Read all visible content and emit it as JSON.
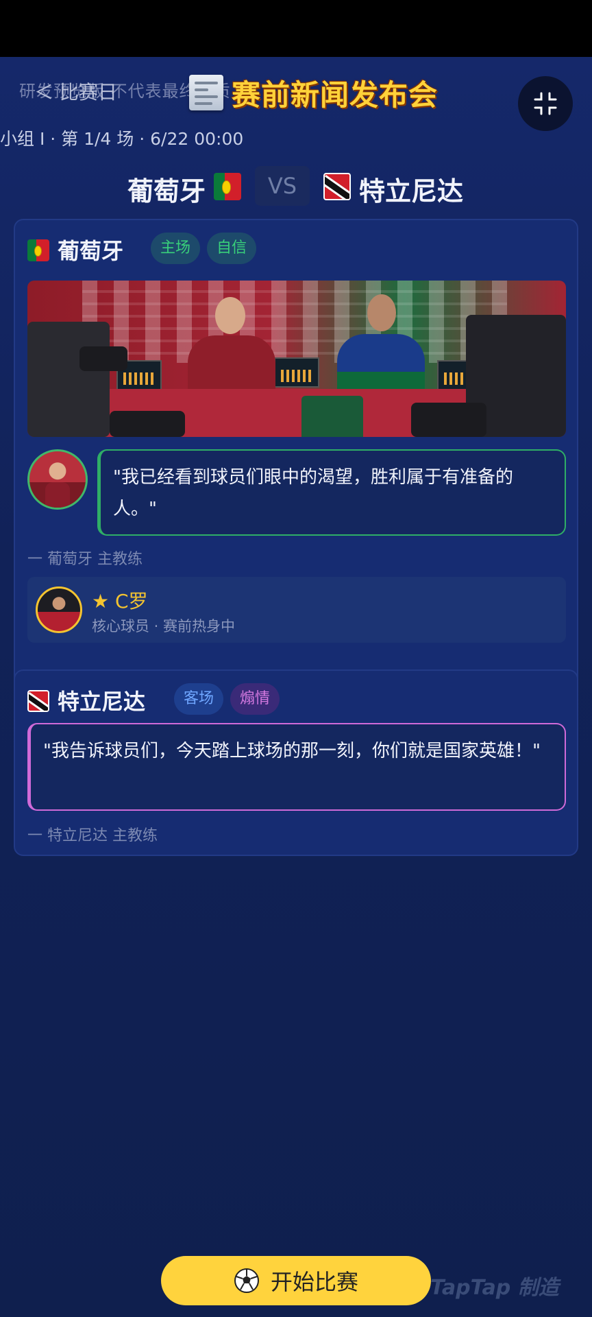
{
  "header": {
    "watermark": "研发预览版  不代表最终品质",
    "back_label": "＜ 比赛日",
    "title": "赛前新闻发布会",
    "collapse_icon": "collapse-icon"
  },
  "match": {
    "info": "小组 I · 第 1/4 场 · 6/22 00:00",
    "home_team": "葡萄牙",
    "vs": "VS",
    "away_team": "特立尼达"
  },
  "home_card": {
    "team": "葡萄牙",
    "tags": [
      "主场",
      "自信"
    ],
    "quote": "\"我已经看到球员们眼中的渴望，胜利属于有准备的人。\"",
    "attribution": "一 葡萄牙 主教练",
    "player": {
      "name": "C罗",
      "star_icon": "★",
      "status": "核心球员 · 赛前热身中"
    },
    "colors": {
      "quote_border": "#2fae66",
      "tag_text": "#39d17a"
    }
  },
  "away_card": {
    "team": "特立尼达",
    "tags": [
      "客场",
      "煽情"
    ],
    "quote": "\"我告诉球员们，今天踏上球场的那一刻，你们就是国家英雄！\"",
    "attribution": "一 特立尼达 主教练",
    "colors": {
      "quote_border": "#d06ad8",
      "tag_1_text": "#6fa6ff",
      "tag_2_text": "#d479e0"
    }
  },
  "footer": {
    "start_button": "开始比赛",
    "ball_icon": "soccer-ball-icon",
    "brand_mark": "TapTap 制造"
  },
  "theme": {
    "background": "#112258",
    "accent_yellow": "#ffd33d"
  }
}
